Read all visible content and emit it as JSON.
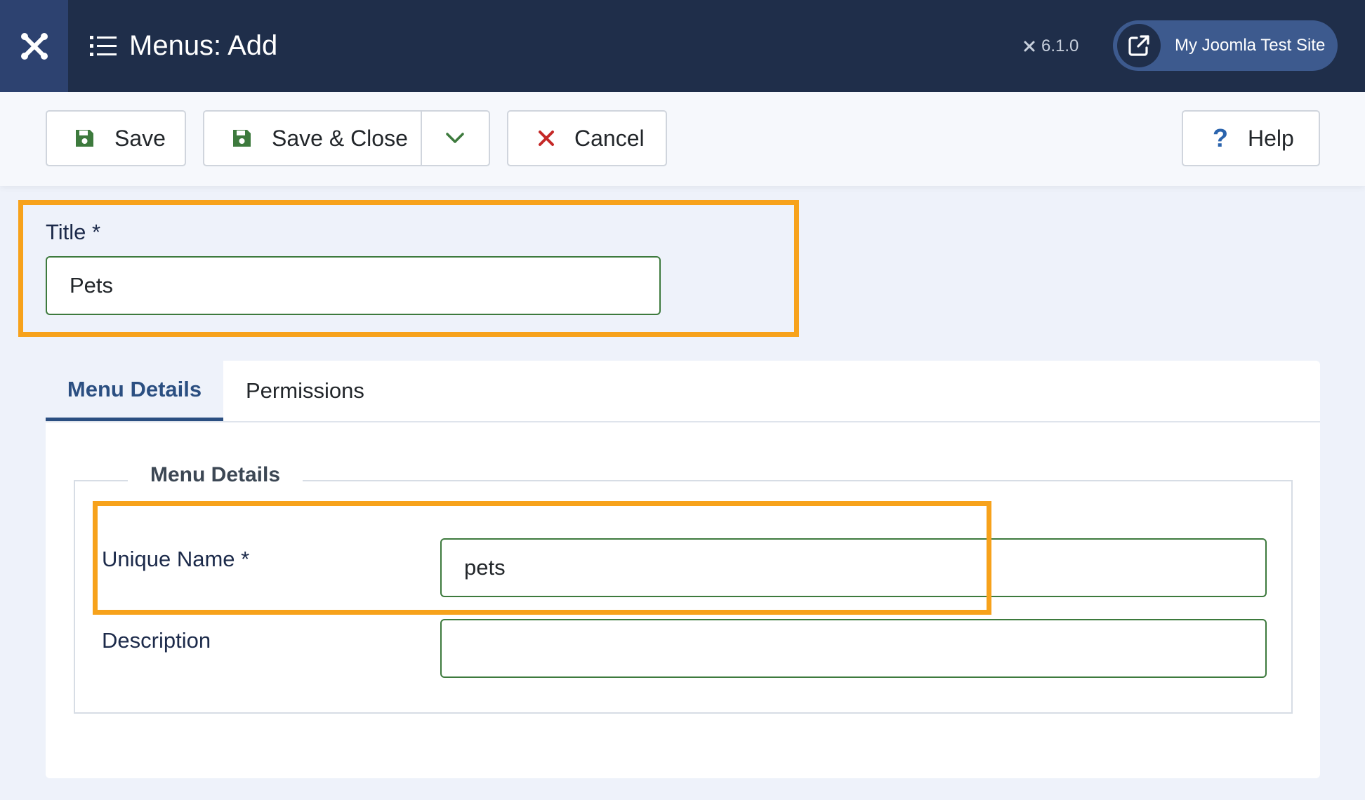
{
  "header": {
    "title": "Menus: Add",
    "version": "6.1.0",
    "site_button": "My Joomla Test Site",
    "logo_icon": "joomla-logo-icon",
    "title_icon": "list-icon",
    "site_icon": "external-link-icon"
  },
  "toolbar": {
    "save_label": "Save",
    "save_close_label": "Save & Close",
    "cancel_label": "Cancel",
    "help_label": "Help"
  },
  "form": {
    "title_label": "Title *",
    "title_value": "Pets"
  },
  "tabs": [
    {
      "label": "Menu Details",
      "active": true
    },
    {
      "label": "Permissions",
      "active": false
    }
  ],
  "details": {
    "legend": "Menu Details",
    "unique_name_label": "Unique Name *",
    "unique_name_value": "pets",
    "description_label": "Description",
    "description_value": ""
  },
  "colors": {
    "header_bg": "#1f2e4a",
    "highlight": "#f7a21b",
    "save_icon": "#3d7a3d",
    "cancel_icon": "#c52827",
    "help_icon": "#2b64ad",
    "active_tab": "#2b4f81"
  }
}
